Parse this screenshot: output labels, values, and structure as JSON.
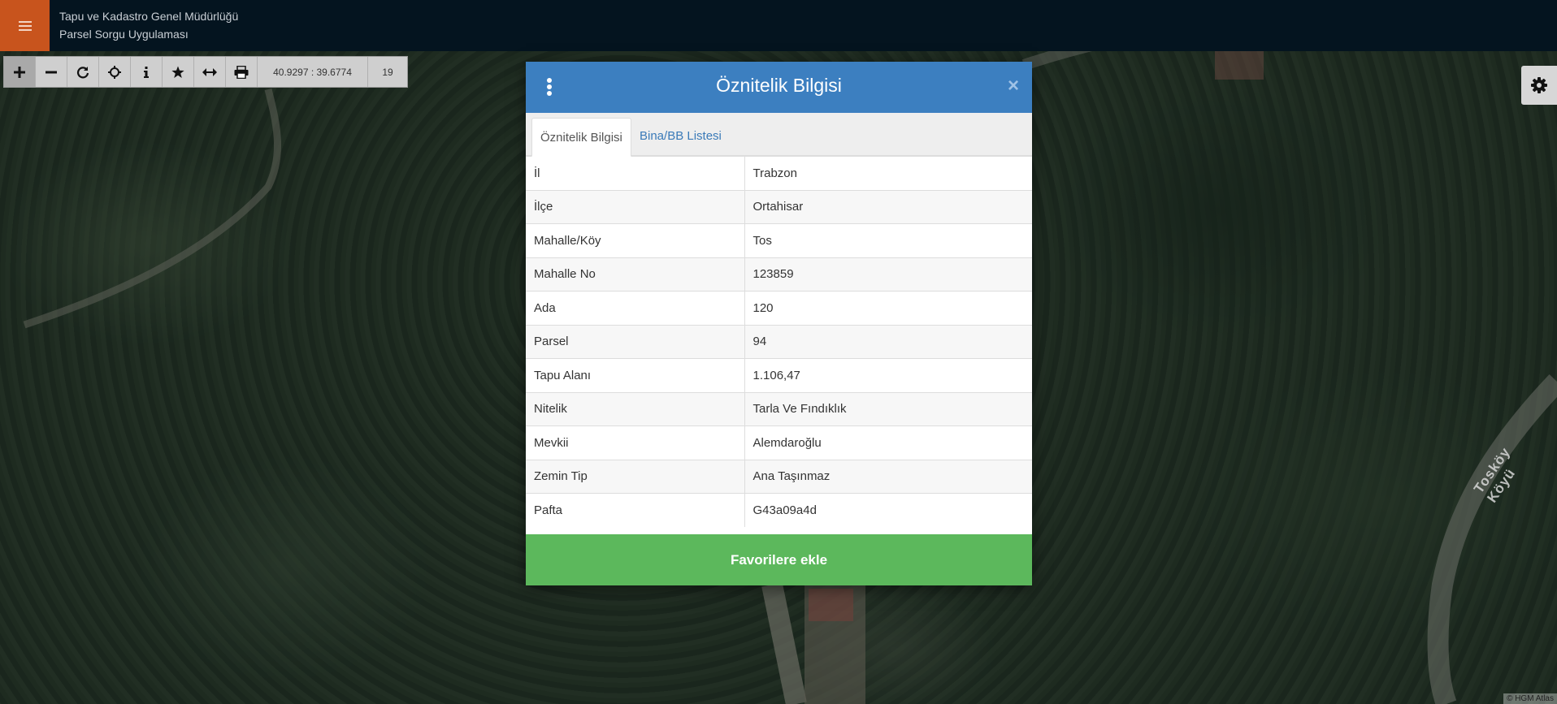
{
  "header": {
    "title_line1": "Tapu ve Kadastro Genel Müdürlüğü",
    "title_line2": "Parsel Sorgu Uygulaması"
  },
  "toolbar": {
    "coordinates": "40.9297 : 39.6774",
    "zoom_level": "19",
    "tools": [
      "zoom-in",
      "zoom-out",
      "refresh",
      "locate",
      "info",
      "favorites",
      "measure",
      "print"
    ]
  },
  "map": {
    "road_label": "Tosköy Köyü",
    "attribution": "© HGM Atlas"
  },
  "modal": {
    "title": "Öznitelik Bilgisi",
    "close_symbol": "×",
    "tabs": [
      {
        "label": "Öznitelik Bilgisi",
        "active": true
      },
      {
        "label": "Bina/BB Listesi",
        "active": false
      }
    ],
    "rows": [
      {
        "key": "İl",
        "value": "Trabzon"
      },
      {
        "key": "İlçe",
        "value": "Ortahisar"
      },
      {
        "key": "Mahalle/Köy",
        "value": "Tos"
      },
      {
        "key": "Mahalle No",
        "value": "123859"
      },
      {
        "key": "Ada",
        "value": "120"
      },
      {
        "key": "Parsel",
        "value": "94"
      },
      {
        "key": "Tapu Alanı",
        "value": "1.106,47"
      },
      {
        "key": "Nitelik",
        "value": "Tarla Ve Fındıklık"
      },
      {
        "key": "Mevkii",
        "value": "Alemdaroğlu"
      },
      {
        "key": "Zemin Tip",
        "value": "Ana Taşınmaz"
      },
      {
        "key": "Pafta",
        "value": "G43a09a4d"
      }
    ],
    "favorite_button": "Favorilere ekle"
  },
  "colors": {
    "header_bg": "#04141f",
    "menu_accent": "#c8541d",
    "modal_header": "#3c7fc0",
    "favorite_button": "#5cb85c",
    "tab_link": "#3a7ab8"
  }
}
